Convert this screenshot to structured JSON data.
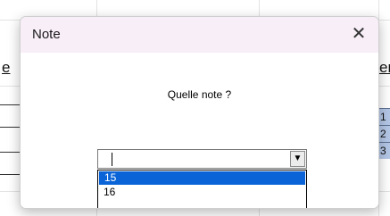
{
  "background": {
    "header_fragments": [
      "e",
      "en"
    ],
    "row_numbers": [
      "1",
      "2",
      "3"
    ]
  },
  "dialog": {
    "title": "Note",
    "close_glyph": "✕",
    "prompt": "Quelle note ?",
    "combo": {
      "value": "",
      "dropdown_glyph": "▼"
    },
    "options": [
      "15",
      "16"
    ],
    "selected_option": "15"
  },
  "colors": {
    "titlebar": "#f7eef7",
    "selection": "#0a64d8",
    "cell_highlight": "#b4c7e7"
  }
}
